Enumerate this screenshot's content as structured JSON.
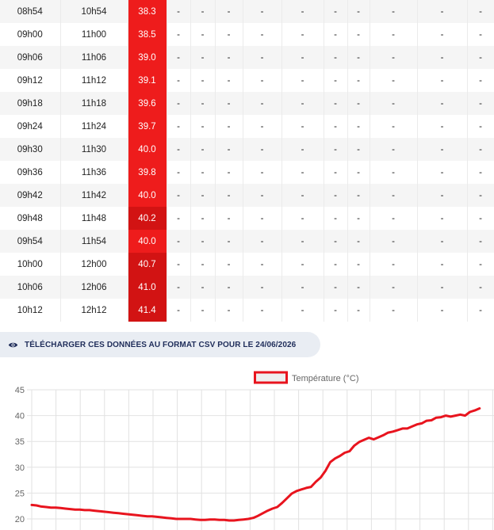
{
  "table": {
    "rows": [
      {
        "utc": "08h54",
        "local": "10h54",
        "temp": "38.3",
        "color": "#ee1c1c"
      },
      {
        "utc": "09h00",
        "local": "11h00",
        "temp": "38.5",
        "color": "#ee1c1c"
      },
      {
        "utc": "09h06",
        "local": "11h06",
        "temp": "39.0",
        "color": "#ee1c1c"
      },
      {
        "utc": "09h12",
        "local": "11h12",
        "temp": "39.1",
        "color": "#ee1c1c"
      },
      {
        "utc": "09h18",
        "local": "11h18",
        "temp": "39.6",
        "color": "#ee1c1c"
      },
      {
        "utc": "09h24",
        "local": "11h24",
        "temp": "39.7",
        "color": "#ee1c1c"
      },
      {
        "utc": "09h30",
        "local": "11h30",
        "temp": "40.0",
        "color": "#ee1c1c"
      },
      {
        "utc": "09h36",
        "local": "11h36",
        "temp": "39.8",
        "color": "#ee1c1c"
      },
      {
        "utc": "09h42",
        "local": "11h42",
        "temp": "40.0",
        "color": "#ee1c1c"
      },
      {
        "utc": "09h48",
        "local": "11h48",
        "temp": "40.2",
        "color": "#d21313"
      },
      {
        "utc": "09h54",
        "local": "11h54",
        "temp": "40.0",
        "color": "#ee1c1c"
      },
      {
        "utc": "10h00",
        "local": "12h00",
        "temp": "40.7",
        "color": "#d21313"
      },
      {
        "utc": "10h06",
        "local": "12h06",
        "temp": "41.0",
        "color": "#d21313"
      },
      {
        "utc": "10h12",
        "local": "12h12",
        "temp": "41.4",
        "color": "#d21313"
      }
    ],
    "empty_value": "-"
  },
  "download": {
    "label": "TÉLÉCHARGER CES DONNÉES AU FORMAT CSV POUR LE 24/06/2026",
    "icon": "eye-icon"
  },
  "chart_data": {
    "type": "line",
    "series": [
      {
        "name": "Température (°C)",
        "color": "#e8141e",
        "values": [
          22.7,
          22.6,
          22.4,
          22.3,
          22.2,
          22.2,
          22.1,
          22.0,
          21.9,
          21.8,
          21.8,
          21.7,
          21.7,
          21.6,
          21.5,
          21.4,
          21.3,
          21.2,
          21.1,
          21.0,
          20.9,
          20.8,
          20.7,
          20.6,
          20.5,
          20.5,
          20.4,
          20.3,
          20.2,
          20.1,
          20.0,
          20.0,
          20.0,
          20.0,
          19.9,
          19.8,
          19.8,
          19.9,
          19.9,
          19.8,
          19.8,
          19.7,
          19.7,
          19.8,
          19.9,
          20.0,
          20.2,
          20.6,
          21.1,
          21.6,
          22.0,
          22.3,
          23.1,
          24.0,
          24.9,
          25.4,
          25.7,
          26.0,
          26.2,
          27.2,
          28.0,
          29.3,
          31.0,
          31.7,
          32.2,
          32.8,
          33.1,
          34.2,
          34.9,
          35.3,
          35.7,
          35.4,
          35.8,
          36.2,
          36.7,
          36.9,
          37.2,
          37.5,
          37.5,
          37.9,
          38.3,
          38.5,
          39.0,
          39.1,
          39.6,
          39.7,
          40.0,
          39.8,
          40.0,
          40.2,
          40.0,
          40.7,
          41.0,
          41.4
        ]
      }
    ],
    "ylim": [
      20,
      45
    ],
    "yticks": [
      20,
      25,
      30,
      35,
      40,
      45
    ],
    "x_slots": 97,
    "grid": true,
    "legend_position": "top"
  }
}
